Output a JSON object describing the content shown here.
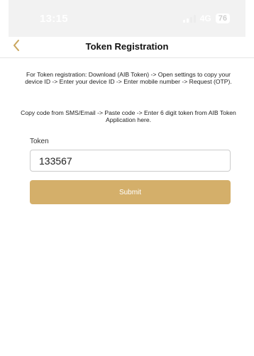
{
  "status_bar": {
    "time": "13:15",
    "network": "4G",
    "battery": "76"
  },
  "nav": {
    "back_icon": "chevron-left-icon",
    "title": "Token Registration"
  },
  "instructions": {
    "step1": "For Token registration: Download (AIB Token) -> Open settings to copy your device ID -> Enter your device ID -> Enter mobile number -> Request (OTP).",
    "step2": "Copy code from SMS/Email -> Paste code -> Enter 6 digit token from AIB Token Application here."
  },
  "form": {
    "token_label": "Token",
    "token_value": "133567",
    "submit_label": "Submit"
  },
  "colors": {
    "accent": "#d4af6a",
    "back_icon": "#c9a55c"
  }
}
